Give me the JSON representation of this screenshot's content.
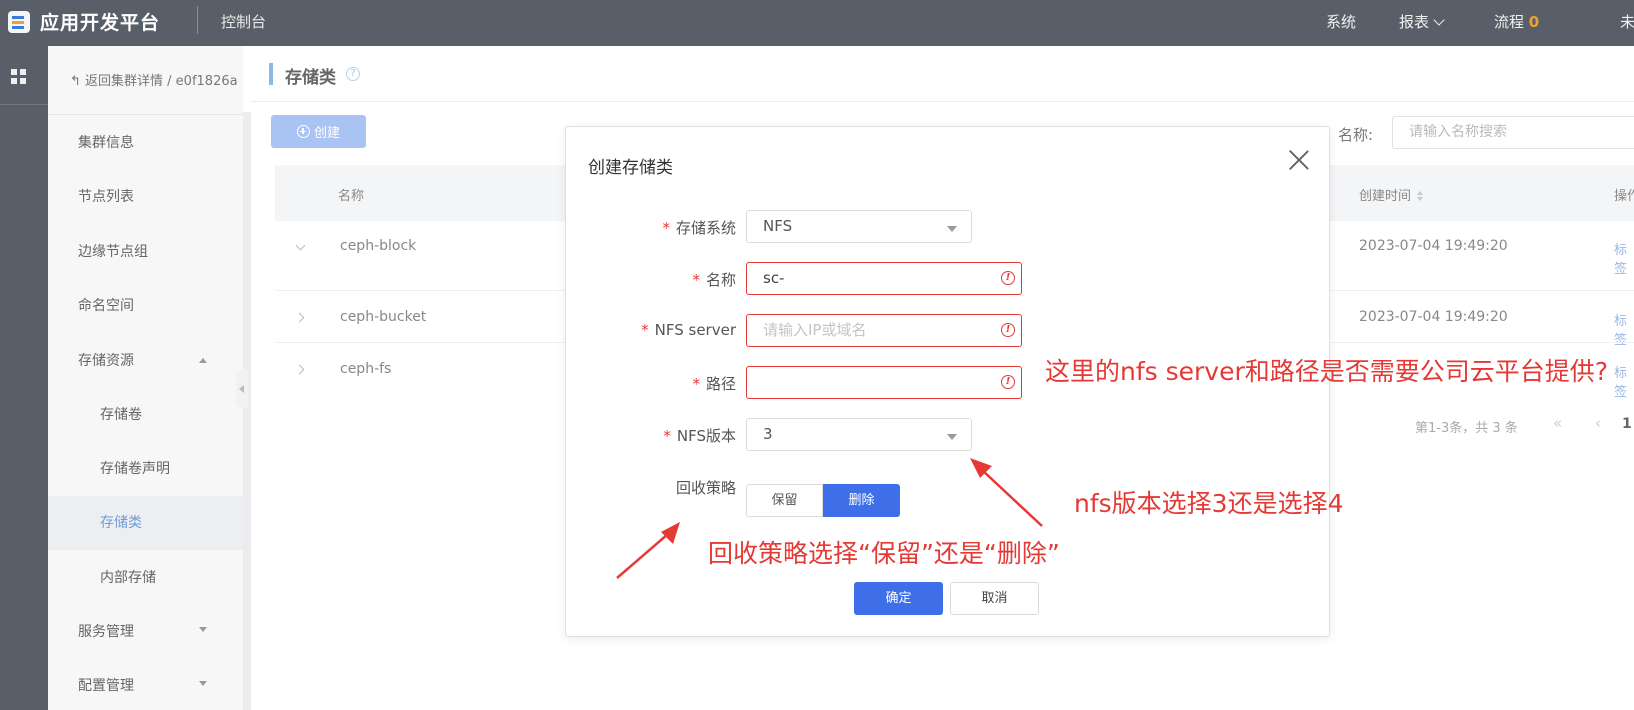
{
  "topbar": {
    "brand": "应用开发平台",
    "console": "控制台",
    "nav": {
      "system": "系统",
      "reports": "报表",
      "flow": "流程",
      "flow_count": "0",
      "cut": "未"
    }
  },
  "sidebar": {
    "back": "返回集群详情 / e0f1826a",
    "items": [
      {
        "label": "集群信息"
      },
      {
        "label": "节点列表"
      },
      {
        "label": "边缘节点组"
      },
      {
        "label": "命名空间"
      },
      {
        "label": "存储资源"
      },
      {
        "label": "存储卷"
      },
      {
        "label": "存储卷声明"
      },
      {
        "label": "存储类"
      },
      {
        "label": "内部存储"
      },
      {
        "label": "服务管理"
      },
      {
        "label": "配置管理"
      }
    ]
  },
  "main": {
    "title": "存储类",
    "help": "?",
    "create_label": "创建",
    "search_label": "名称:",
    "search_placeholder": "请输入名称搜索",
    "columns": {
      "name": "名称",
      "created": "创建时间",
      "actions": "操作"
    },
    "rows": [
      {
        "name": "ceph-block",
        "created": "2023-07-04 19:49:20",
        "action": "标签"
      },
      {
        "name": "ceph-bucket",
        "created": "2023-07-04 19:49:20",
        "action": "标签"
      },
      {
        "name": "ceph-fs",
        "created": "",
        "action": "标签"
      }
    ],
    "pager_text": "第1-3条，共 3 条",
    "pager_arrows": "« ‹",
    "pager_page": "1"
  },
  "modal": {
    "title": "创建存储类",
    "fields": {
      "storage_system": {
        "label": "存储系统",
        "value": "NFS"
      },
      "name": {
        "label": "名称",
        "value": "sc-"
      },
      "nfs_server": {
        "label": "NFS server",
        "placeholder": "请输入IP或域名"
      },
      "path": {
        "label": "路径",
        "value": ""
      },
      "nfs_version": {
        "label": "NFS版本",
        "value": "3"
      },
      "reclaim": {
        "label": "回收策略",
        "options": [
          "保留",
          "删除"
        ],
        "selected": "删除"
      }
    },
    "required_mark": "*",
    "ok": "确定",
    "cancel": "取消"
  },
  "annotations": {
    "q1": "这里的nfs server和路径是否需要公司云平台提供?",
    "q2": "nfs版本选择3还是选择4",
    "q3": "回收策略选择“保留”还是“删除”",
    "color": "#e53935"
  }
}
